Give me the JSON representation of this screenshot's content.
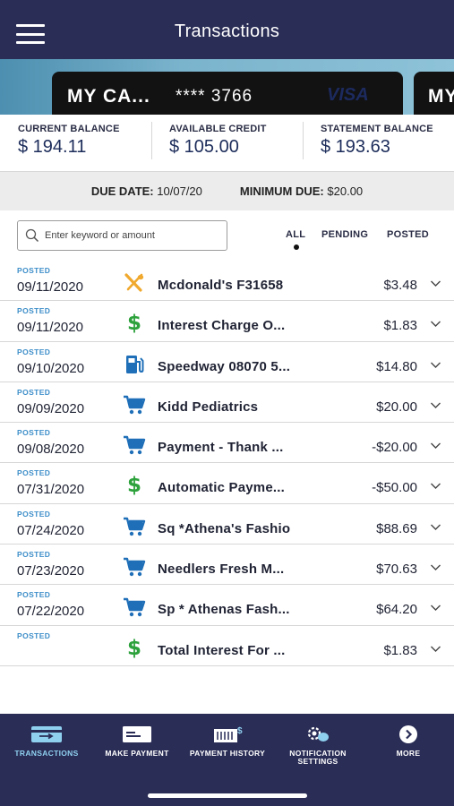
{
  "header": {
    "title": "Transactions",
    "menu_icon": "hamburger-menu-icon"
  },
  "cards": [
    {
      "name": "MY CA...",
      "number": "**** 3766",
      "brand": "VISA"
    },
    {
      "name": "MY"
    }
  ],
  "balances": [
    {
      "label": "CURRENT BALANCE",
      "value": "$ 194.11"
    },
    {
      "label": "AVAILABLE CREDIT",
      "value": "$ 105.00"
    },
    {
      "label": "STATEMENT BALANCE",
      "value": "$ 193.63"
    }
  ],
  "due": {
    "due_date_label": "DUE DATE:",
    "due_date": "10/07/20",
    "min_due_label": "MINIMUM DUE:",
    "min_due": "$20.00"
  },
  "search": {
    "placeholder": "Enter keyword or amount"
  },
  "filters": {
    "all": "ALL",
    "pending": "PENDING",
    "posted": "POSTED",
    "selected": "ALL"
  },
  "transactions": [
    {
      "status": "POSTED",
      "date": "09/11/2020",
      "icon": "restaurant-icon",
      "merchant": "Mcdonald's F31658",
      "amount": "$3.48"
    },
    {
      "status": "POSTED",
      "date": "09/11/2020",
      "icon": "dollar-icon",
      "merchant": "Interest Charge O...",
      "amount": "$1.83"
    },
    {
      "status": "POSTED",
      "date": "09/10/2020",
      "icon": "gas-station-icon",
      "merchant": "Speedway 08070 5...",
      "amount": "$14.80"
    },
    {
      "status": "POSTED",
      "date": "09/09/2020",
      "icon": "shopping-cart-icon",
      "merchant": "Kidd Pediatrics",
      "amount": "$20.00"
    },
    {
      "status": "POSTED",
      "date": "09/08/2020",
      "icon": "shopping-cart-icon",
      "merchant": "Payment - Thank ...",
      "amount": "-$20.00"
    },
    {
      "status": "POSTED",
      "date": "07/31/2020",
      "icon": "dollar-icon",
      "merchant": "Automatic Payme...",
      "amount": "-$50.00"
    },
    {
      "status": "POSTED",
      "date": "07/24/2020",
      "icon": "shopping-cart-icon",
      "merchant": "Sq *Athena's Fashio",
      "amount": "$88.69"
    },
    {
      "status": "POSTED",
      "date": "07/23/2020",
      "icon": "shopping-cart-icon",
      "merchant": "Needlers Fresh M...",
      "amount": "$70.63"
    },
    {
      "status": "POSTED",
      "date": "07/22/2020",
      "icon": "shopping-cart-icon",
      "merchant": "Sp * Athenas Fash...",
      "amount": "$64.20"
    },
    {
      "status": "POSTED",
      "date": "",
      "icon": "dollar-icon",
      "merchant": "Total Interest For ...",
      "amount": "$1.83"
    }
  ],
  "nav": [
    {
      "label": "TRANSACTIONS",
      "icon": "transactions-icon",
      "active": true
    },
    {
      "label": "MAKE PAYMENT",
      "icon": "make-payment-icon"
    },
    {
      "label": "PAYMENT HISTORY",
      "icon": "payment-history-icon"
    },
    {
      "label": "NOTIFICATION SETTINGS",
      "icon": "notification-settings-icon"
    },
    {
      "label": "MORE",
      "icon": "more-icon"
    }
  ],
  "colors": {
    "header_bg": "#2a2d56",
    "status_blue": "#3d8ec9",
    "dollar_green": "#2da23c",
    "restaurant_orange": "#f0a92e",
    "cart_blue": "#1f6fb8",
    "nav_active": "#8fd0ef"
  }
}
